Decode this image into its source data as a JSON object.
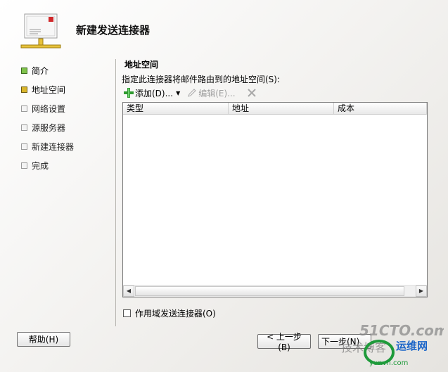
{
  "header": {
    "title": "新建发送连接器",
    "icon": "mail-connector-icon"
  },
  "steps": [
    {
      "label": "简介",
      "state": "done"
    },
    {
      "label": "地址空间",
      "state": "current"
    },
    {
      "label": "网络设置",
      "state": "pending"
    },
    {
      "label": "源服务器",
      "state": "pending"
    },
    {
      "label": "新建连接器",
      "state": "pending"
    },
    {
      "label": "完成",
      "state": "pending"
    }
  ],
  "main": {
    "section_title": "地址空间",
    "description": "指定此连接器将邮件路由到的地址空间(S):",
    "toolbar": {
      "add_label": "添加(D)...",
      "edit_label": "编辑(E)..."
    },
    "table": {
      "columns": [
        "类型",
        "地址",
        "成本"
      ],
      "rows": []
    },
    "checkbox_label": "作用域发送连接器(O)",
    "checkbox_checked": false
  },
  "footer": {
    "help_label": "帮助(H)",
    "back_label": "< 上一步(B)",
    "next_label": "下一步(N)"
  },
  "watermark": {
    "line1": "51CTO.com",
    "line2": "技术博客",
    "line3": "运维网",
    "line4": "yunvn.com"
  },
  "colors": {
    "done": "#7fc24a",
    "current": "#d9b52a",
    "add_icon": "#2f9a2f"
  }
}
